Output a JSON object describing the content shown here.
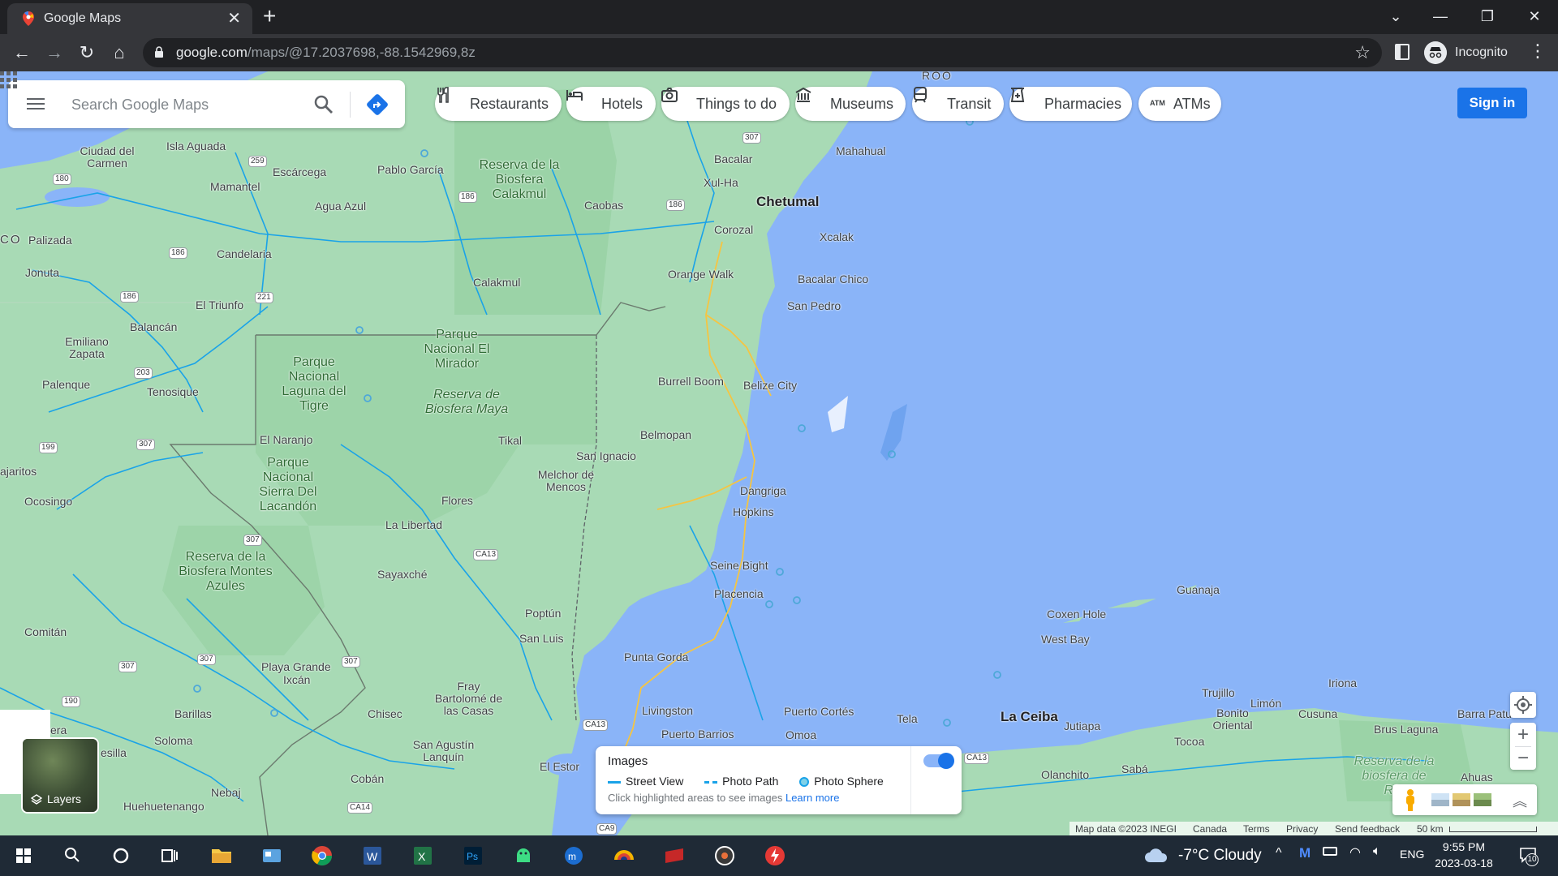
{
  "browser": {
    "tab_title": "Google Maps",
    "url_host": "google.com",
    "url_path": "/maps/@17.2037698,-88.1542969,8z",
    "profile_label": "Incognito"
  },
  "search": {
    "placeholder": "Search Google Maps"
  },
  "chips": [
    {
      "label": "Restaurants",
      "icon": "fork-knife-icon"
    },
    {
      "label": "Hotels",
      "icon": "bed-icon"
    },
    {
      "label": "Things to do",
      "icon": "camera-icon"
    },
    {
      "label": "Museums",
      "icon": "museum-icon"
    },
    {
      "label": "Transit",
      "icon": "train-icon"
    },
    {
      "label": "Pharmacies",
      "icon": "pharmacy-icon"
    },
    {
      "label": "ATMs",
      "icon": "atm-icon"
    }
  ],
  "header": {
    "sign_in": "Sign in"
  },
  "map": {
    "places": {
      "roo": "ROO",
      "ciudad_del_carmen": "Ciudad del Carmen",
      "isla_aguada": "Isla Aguada",
      "mamantel": "Mamantel",
      "escarcega": "Escárcega",
      "pablo_garcia": "Pablo García",
      "agua_azul": "Agua Azul",
      "caobas": "Caobas",
      "bacalar": "Bacalar",
      "xul_ha": "Xul-Ha",
      "mahahual": "Mahahual",
      "chetumal": "Chetumal",
      "xcalak": "Xcalak",
      "corozal": "Corozal",
      "co": "CO",
      "palizada": "Palizada",
      "candelaria": "Candelaria",
      "jonuta": "Jonuta",
      "orange_walk": "Orange Walk",
      "calakmul": "Calakmul",
      "bacalar_chico": "Bacalar Chico",
      "el_triunfo": "El Triunfo",
      "san_pedro": "San Pedro",
      "balancan": "Balancán",
      "emiliano_zapata": "Emiliano Zapata",
      "palenque": "Palenque",
      "tenosique": "Tenosique",
      "burrell_boom": "Burrell Boom",
      "belize_city": "Belize City",
      "el_naranjo": "El Naranjo",
      "tikal": "Tikal",
      "belmopan": "Belmopan",
      "san_ignacio": "San Ignacio",
      "pajaritos": "ajaritos",
      "melchor": "Melchor de Mencos",
      "flores": "Flores",
      "dangriga": "Dangriga",
      "hopkins": "Hopkins",
      "ocosingo": "Ocosingo",
      "la_libertad": "La Libertad",
      "seine_bight": "Seine Bight",
      "placencia": "Placencia",
      "sayaxche": "Sayaxché",
      "guanaja": "Guanaja",
      "coxen_hole": "Coxen Hole",
      "west_bay": "West Bay",
      "poptun": "Poptún",
      "san_luis": "San Luis",
      "comitan": "Comitán",
      "punta_gorda": "Punta Gorda",
      "playa_grande": "Playa Grande",
      "ixcan": "Ixcán",
      "iriona": "Iriona",
      "trujillo": "Trujillo",
      "limon": "Limón",
      "la_ceiba": "La Ceiba",
      "bonito_oriental": "Bonito Oriental",
      "cusuna": "Cusuna",
      "barra_patuca": "Barra Patu",
      "livingston": "Livingston",
      "puerto_cortes": "Puerto Cortés",
      "tela": "Tela",
      "jutiapa": "Jutiapa",
      "barillas": "Barillas",
      "chisec": "Chisec",
      "fray": "Fray Bartolomé de las Casas",
      "puerto_barrios": "Puerto Barrios",
      "omoa": "Omoa",
      "brus_laguna": "Brus Laguna",
      "tocoa": "Tocoa",
      "soloma": "Soloma",
      "mesilla": "esilla",
      "san_agustin": "San Agustín Lanquín",
      "el_estor": "El Estor",
      "olanchito": "Olanchito",
      "saba": "Sabá",
      "ahuas": "Ahuas",
      "era": "era",
      "coban": "Cobán",
      "nebaj": "Nebaj",
      "huehuetenango": "Huehuetenango"
    },
    "parks": {
      "calakmul_reserve": "Reserva de la Biosfera Calakmul",
      "mirador": "Parque Nacional El Mirador",
      "laguna_tigre": "Parque Nacional Laguna del Tigre",
      "maya_reserve": "Reserva de Biosfera Maya",
      "sierra_lacandon": "Parque Nacional Sierra Del Lacandón",
      "montes_azules": "Reserva de la Biosfera Montes Azules",
      "rio_platano": "Reserva de la biosfera de Río"
    },
    "shields": {
      "s180": "180",
      "s259": "259",
      "s186a": "186",
      "s186b": "186",
      "s186c": "186",
      "s186d": "186",
      "s221": "221",
      "s203": "203",
      "s307a": "307",
      "s199": "199",
      "s307b": "307",
      "s307c": "307",
      "s307d": "307",
      "s307e": "307",
      "s190": "190",
      "ca13a": "CA13",
      "ca13b": "CA13",
      "ca13c": "CA13",
      "ca14": "CA14",
      "ca9": "CA9",
      "s293": "293"
    }
  },
  "images_panel": {
    "title": "Images",
    "street_view": "Street View",
    "photo_path": "Photo Path",
    "photo_sphere": "Photo Sphere",
    "hint": "Click highlighted areas to see images",
    "learn_more": "Learn more",
    "toggle_on": true
  },
  "layers": {
    "label": "Layers"
  },
  "footer": {
    "map_data": "Map data ©2023 INEGI",
    "canada": "Canada",
    "terms": "Terms",
    "privacy": "Privacy",
    "feedback": "Send feedback",
    "scale": "50 km"
  },
  "taskbar": {
    "weather": "-7°C  Cloudy",
    "lang": "ENG",
    "time": "9:55 PM",
    "date": "2023-03-18",
    "notifications": "10"
  },
  "colors": {
    "water": "#8ab4f8",
    "land": "#a8dab5",
    "road": "#1aa3e8",
    "accent": "#1a73e8"
  }
}
